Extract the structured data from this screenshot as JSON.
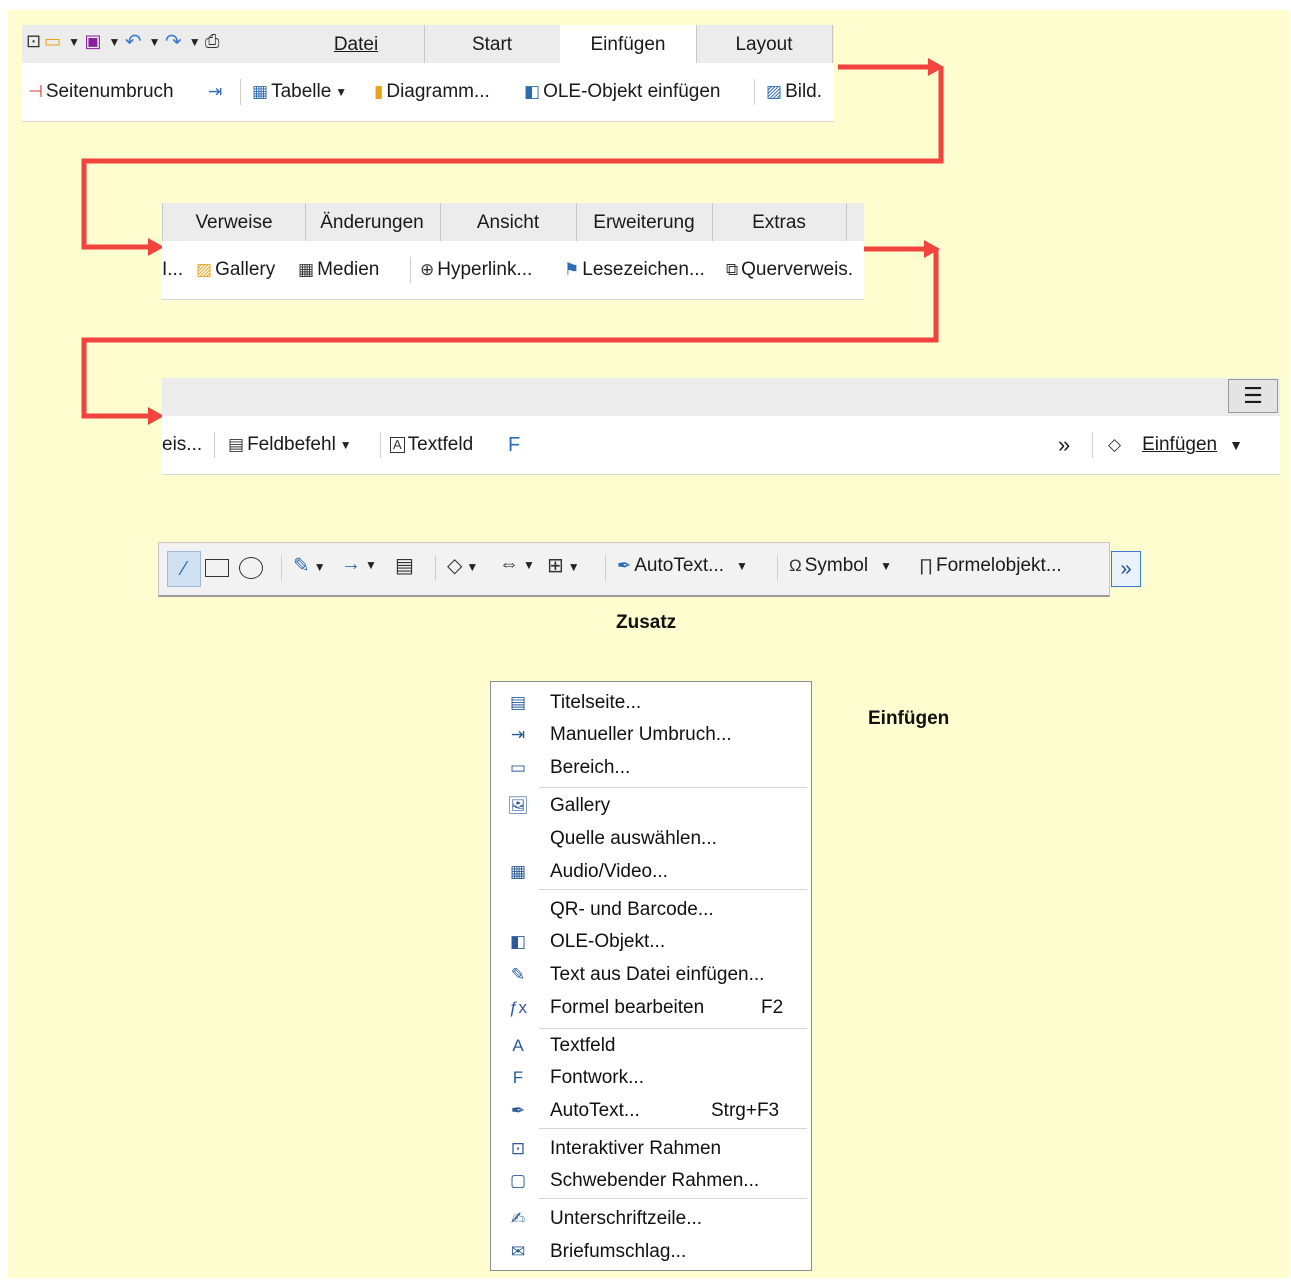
{
  "colors": {
    "background": "#fefdcf",
    "arrow": "#f2433e",
    "accent": "#2d6bb3"
  },
  "panel1": {
    "quick_icons": [
      {
        "name": "new-document-icon",
        "glyph": "🗔"
      },
      {
        "name": "open-folder-icon",
        "glyph": "📂"
      },
      {
        "name": "save-icon",
        "glyph": "💾"
      },
      {
        "name": "undo-icon",
        "glyph": "↶"
      },
      {
        "name": "redo-icon",
        "glyph": "↷"
      },
      {
        "name": "print-icon",
        "glyph": "🖶"
      }
    ],
    "tabs": [
      "Datei",
      "Start",
      "Einfügen",
      "Layout"
    ],
    "toolbar": {
      "page_break": "Seitenumbruch",
      "table": "Tabelle",
      "chart": "Diagramm...",
      "ole": "OLE-Objekt einfügen",
      "image": "Bild."
    }
  },
  "panel2": {
    "tabs": [
      "Verweise",
      "Änderungen",
      "Ansicht",
      "Erweiterung",
      "Extras"
    ],
    "toolbar": {
      "cut_left": "I...",
      "gallery": "Gallery",
      "media": "Medien",
      "hyperlink": "Hyperlink...",
      "bookmark": "Lesezeichen...",
      "crossref": "Querverweis."
    }
  },
  "panel3": {
    "toolbar": {
      "cut_left": "eis...",
      "field": "Feldbefehl",
      "textbox": "Textfeld",
      "overflow": "»",
      "menu_label": "Einfügen"
    }
  },
  "zusatz": {
    "autotext": "AutoText...",
    "symbol": "Symbol",
    "formula": "Formelobjekt...",
    "overflow": "»",
    "caption": "Zusatz"
  },
  "menu": {
    "caption": "Einfügen",
    "items": [
      {
        "label": "Titelseite...",
        "icon": "title-page-icon",
        "glyph": "▤",
        "shortcut": ""
      },
      {
        "label": "Manueller Umbruch...",
        "icon": "manual-break-icon",
        "glyph": "⇥",
        "shortcut": ""
      },
      {
        "label": "Bereich...",
        "icon": "section-icon",
        "glyph": "▭",
        "shortcut": ""
      },
      {
        "label": "Gallery",
        "icon": "gallery-icon",
        "glyph": "🖼",
        "shortcut": ""
      },
      {
        "label": "Quelle auswählen...",
        "icon": "",
        "glyph": "",
        "shortcut": ""
      },
      {
        "label": "Audio/Video...",
        "icon": "media-icon",
        "glyph": "▦",
        "shortcut": ""
      },
      {
        "label": "QR- und Barcode...",
        "icon": "",
        "glyph": "",
        "shortcut": ""
      },
      {
        "label": "OLE-Objekt...",
        "icon": "ole-object-icon",
        "glyph": "◧",
        "shortcut": ""
      },
      {
        "label": "Text aus Datei einfügen...",
        "icon": "text-from-file-icon",
        "glyph": "✎",
        "shortcut": ""
      },
      {
        "label": "Formel bearbeiten",
        "icon": "formula-icon",
        "glyph": "ƒx",
        "shortcut": "F2"
      },
      {
        "label": "Textfeld",
        "icon": "textbox-icon",
        "glyph": "A",
        "shortcut": ""
      },
      {
        "label": "Fontwork...",
        "icon": "fontwork-icon",
        "glyph": "F",
        "shortcut": ""
      },
      {
        "label": "AutoText...",
        "icon": "autotext-icon",
        "glyph": "✒",
        "shortcut": "Strg+F3"
      },
      {
        "label": "Interaktiver Rahmen",
        "icon": "interactive-frame-icon",
        "glyph": "⊡",
        "shortcut": ""
      },
      {
        "label": "Schwebender Rahmen...",
        "icon": "floating-frame-icon",
        "glyph": "▢",
        "shortcut": ""
      },
      {
        "label": "Unterschriftzeile...",
        "icon": "signature-line-icon",
        "glyph": "✍",
        "shortcut": ""
      },
      {
        "label": "Briefumschlag...",
        "icon": "envelope-icon",
        "glyph": "✉",
        "shortcut": ""
      }
    ]
  }
}
